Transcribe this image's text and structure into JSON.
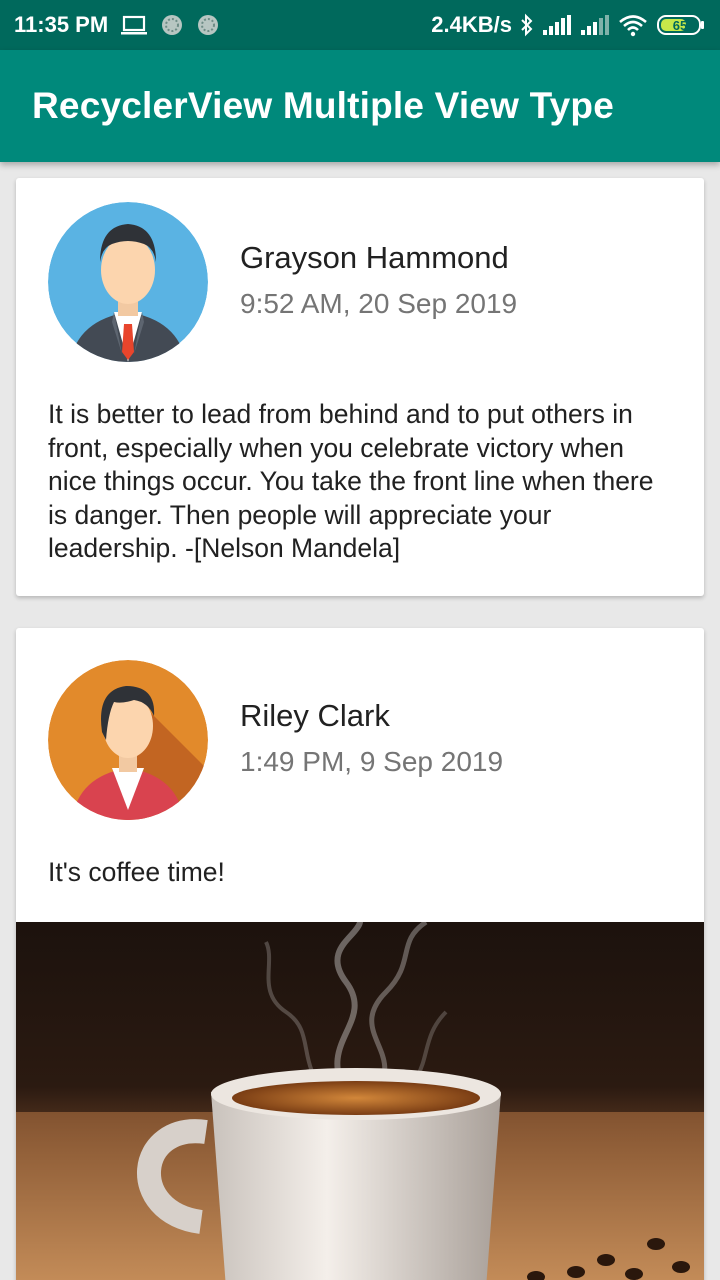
{
  "status_bar": {
    "time": "11:35 PM",
    "speed": "2.4KB/s",
    "battery": "65"
  },
  "app_bar": {
    "title": "RecyclerView Multiple View Type"
  },
  "posts": [
    {
      "name": "Grayson Hammond",
      "time": "9:52 AM, 20 Sep 2019",
      "text": "It is better to lead from behind and to put others in front, especially when you celebrate victory when nice things occur. You take the front line when there is danger. Then people will appreciate your leadership. -[Nelson Mandela]"
    },
    {
      "name": "Riley Clark",
      "time": "1:49 PM, 9 Sep 2019",
      "text": "It's coffee time!"
    }
  ],
  "colors": {
    "primary": "#00897b",
    "primary_dark": "#00695c",
    "background": "#e8e8e8"
  }
}
